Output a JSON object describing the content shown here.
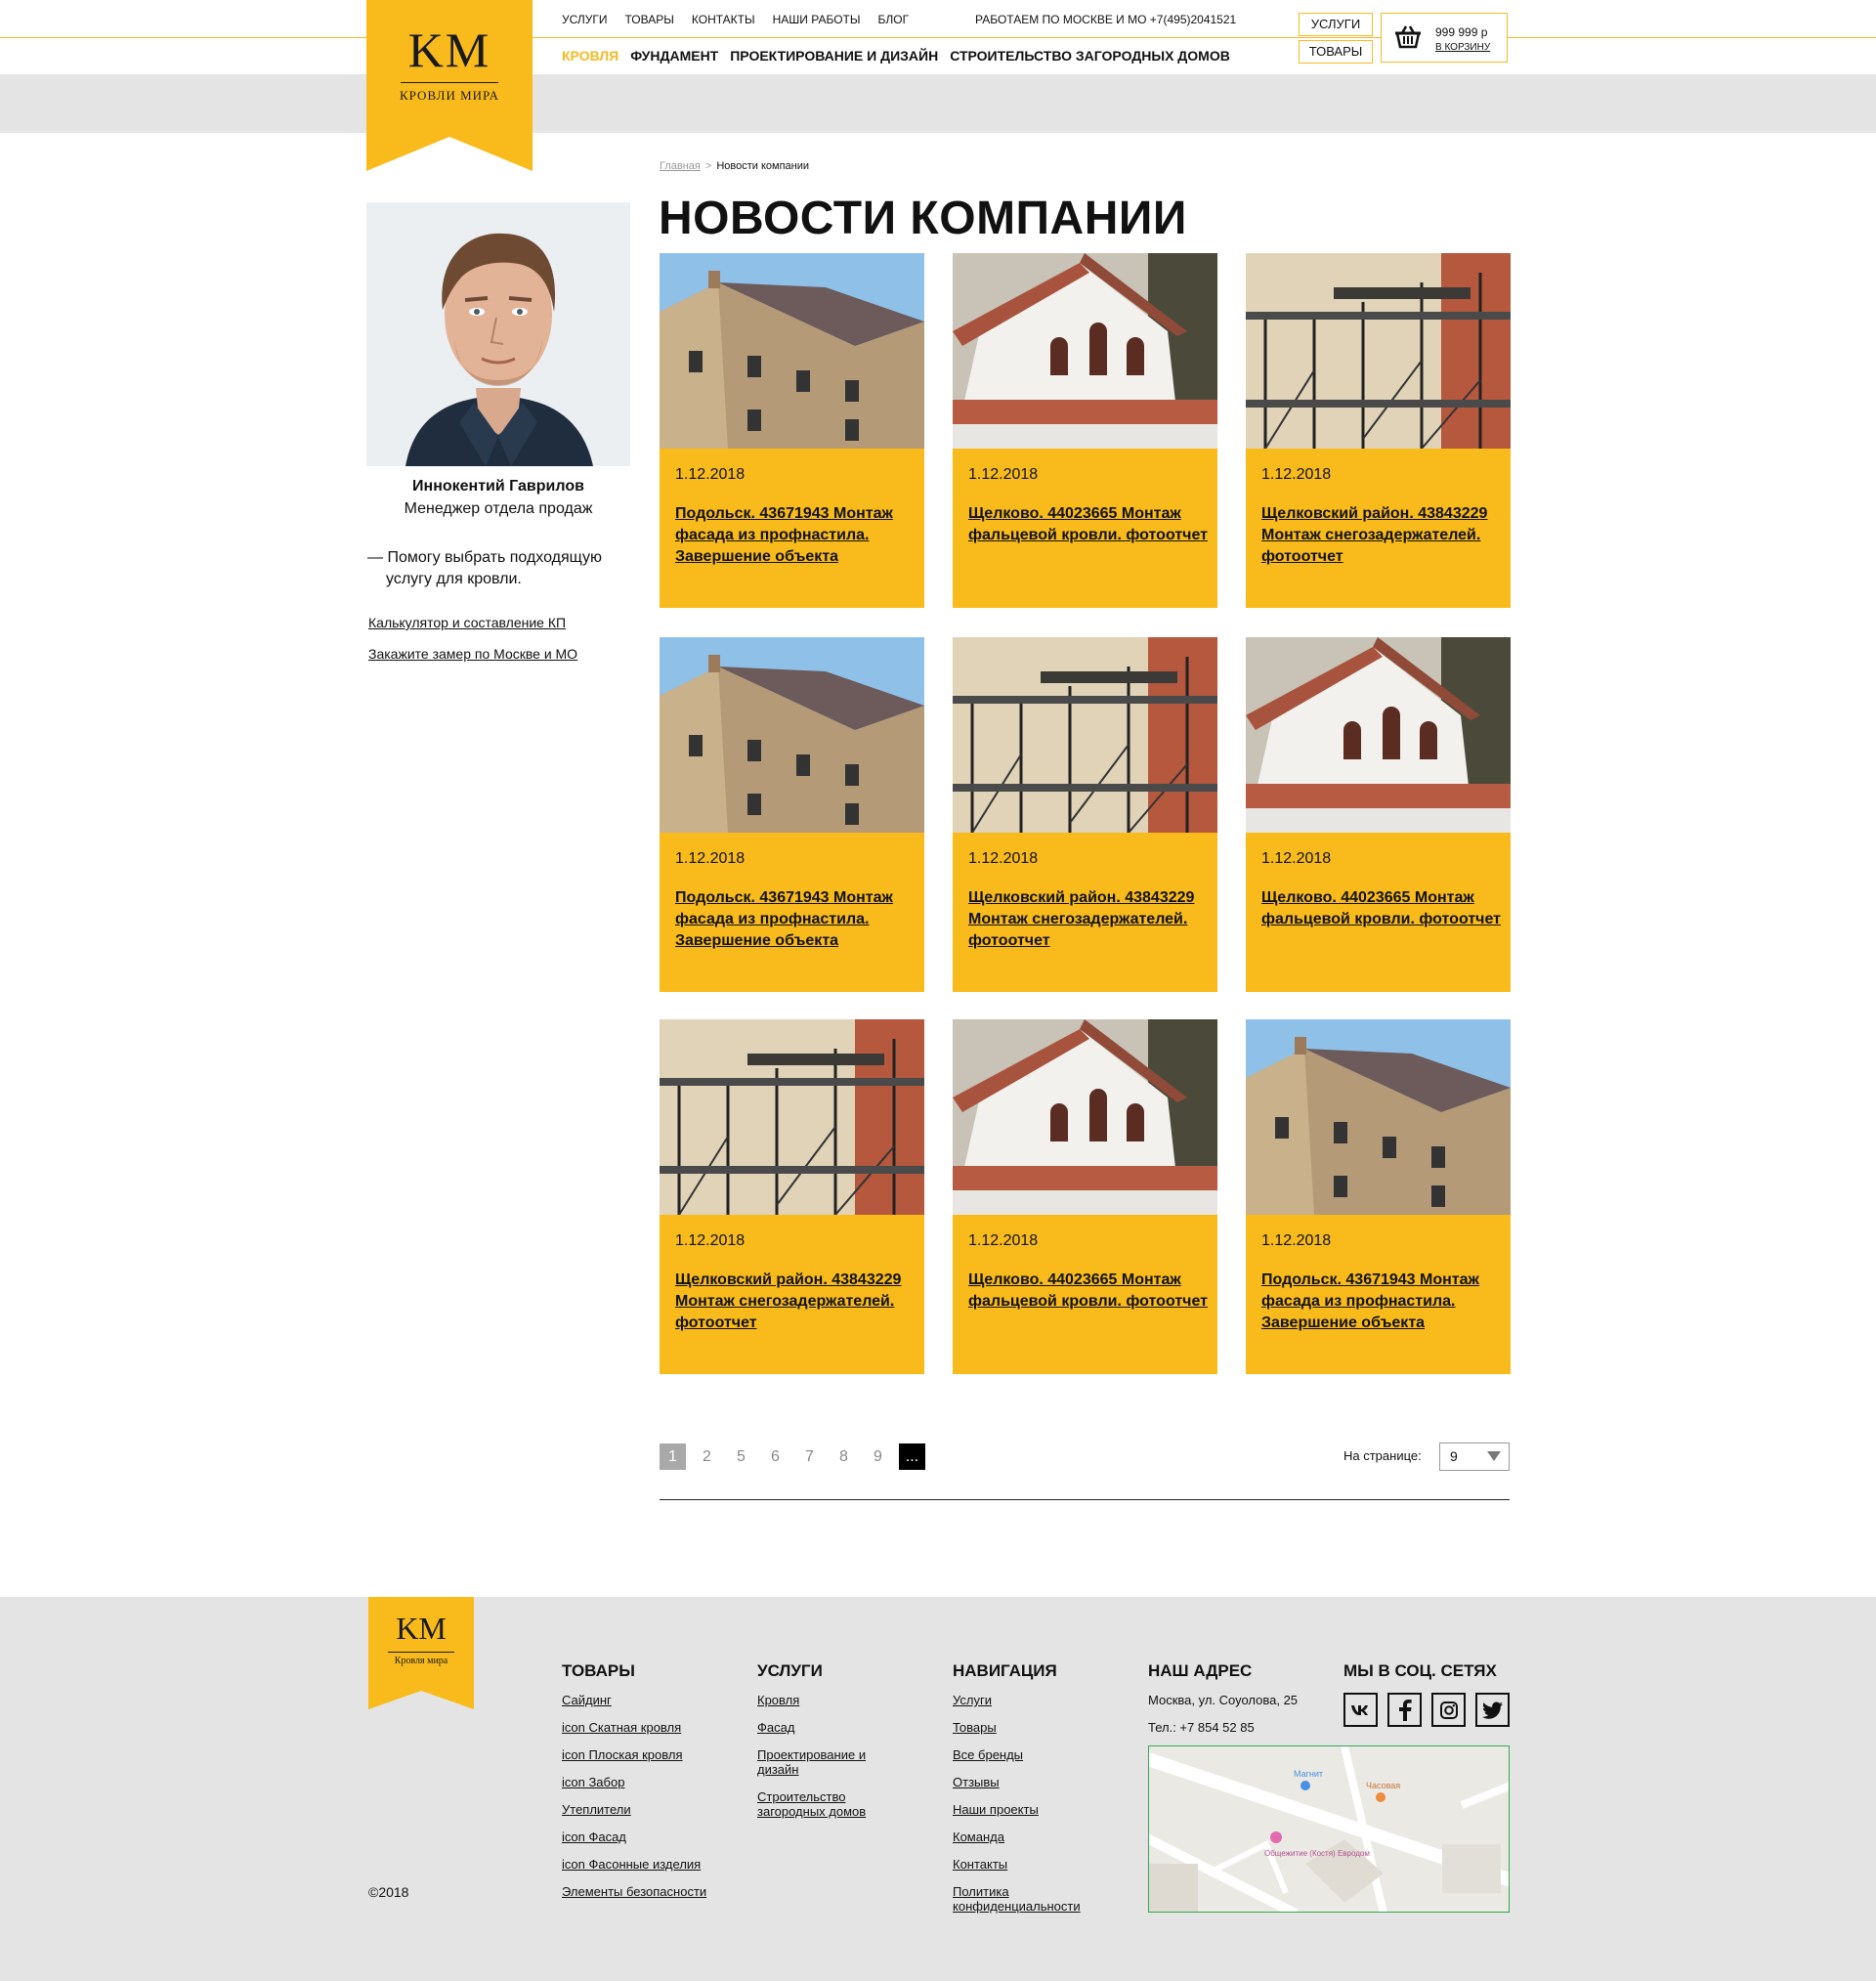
{
  "header": {
    "logo": "KM",
    "logo_sub": "КРОВЛИ МИРА",
    "top_nav": [
      "Услуги",
      "Товары",
      "Контакты",
      "Наши работы",
      "Блог"
    ],
    "worktime": "РАБОТАЕМ ПО МОСКВЕ И МО +7(495)2041521",
    "main_nav": [
      "Кровля",
      "Фундамент",
      "Проектирование и дизайн",
      "Строительство загородных домов"
    ],
    "btn_services": "УСЛУГИ",
    "btn_goods": "ТОВАРЫ",
    "cart_sum": "999 999 р",
    "cart_link": "В КОРЗИНУ"
  },
  "manager": {
    "name": "Иннокентий Гаврилов",
    "role": "Менеджер отдела продаж",
    "help": "— Помогу выбрать подходящую услугу для кровли.",
    "link1": "Калькулятор и составление КП",
    "link2": "Закажите замер по Москве и МО"
  },
  "breadcrumbs": {
    "home": "Главная",
    "sep": ">",
    "current": "Новости компании"
  },
  "title": "НОВОСТИ КОМПАНИИ",
  "news": [
    {
      "date": "1.12.2018",
      "title": "Подольск. 43671943 Монтаж фасада из профнастила. Завершение объекта",
      "img": "brick"
    },
    {
      "date": "1.12.2018",
      "title": "Щелково. 44023665 Монтаж фальцевой кровли. фотоотчет",
      "img": "white"
    },
    {
      "date": "1.12.2018",
      "title": "Щелковский район. 43843229 Монтаж снегозадержателей. фотоотчет",
      "img": "scaffold"
    },
    {
      "date": "1.12.2018",
      "title": "Подольск. 43671943 Монтаж фасада из профнастила. Завершение объекта",
      "img": "brick"
    },
    {
      "date": "1.12.2018",
      "title": "Щелковский район. 43843229 Монтаж снегозадержателей. фотоотчет",
      "img": "scaffold"
    },
    {
      "date": "1.12.2018",
      "title": "Щелково. 44023665 Монтаж фальцевой кровли. фотоотчет",
      "img": "white"
    },
    {
      "date": "1.12.2018",
      "title": "Щелковский район. 43843229 Монтаж снегозадержателей. фотоотчет",
      "img": "scaffold"
    },
    {
      "date": "1.12.2018",
      "title": "Щелково. 44023665 Монтаж фальцевой кровли. фотоотчет",
      "img": "white"
    },
    {
      "date": "1.12.2018",
      "title": "Подольск. 43671943 Монтаж фасада из профнастила. Завершение объекта",
      "img": "brick"
    }
  ],
  "pagination": {
    "pages": [
      "1",
      "2",
      "5",
      "6",
      "7",
      "8",
      "9"
    ],
    "more": "...",
    "current": "1",
    "per_page_label": "На странице:",
    "per_page": "9"
  },
  "footer": {
    "logo": "KM",
    "logo_sub": "Кровля мира",
    "goods_title": "ТОВАРЫ",
    "goods": [
      "Сайдинг",
      "icon Скатная кровля",
      "icon Плоская кровля",
      "icon Забор",
      "Утеплители",
      "icon Фасад",
      "icon Фасонные изделия",
      "Элементы безопасности"
    ],
    "services_title": "УСЛУГИ",
    "services": [
      "Кровля",
      "Фасад",
      "Проектирование и дизайн",
      "Строительство загородных домов"
    ],
    "nav_title": "НАВИГАЦИЯ",
    "nav": [
      "Услуги",
      "Товары",
      "Все бренды",
      "Отзывы",
      "Наши проекты",
      "Команда",
      "Контакты",
      "Политика конфиденциальности"
    ],
    "address_title": "НАШ АДРЕС",
    "address": "Москва, ул. Соуолова, 25",
    "phone": "Тел.: +7 854 52 85",
    "social_title": "МЫ В СОЦ. СЕТЯХ",
    "social": [
      "vk-icon",
      "facebook-icon",
      "instagram-icon",
      "twitter-icon"
    ],
    "map_labels": [
      "Магнит",
      "Часовая",
      "Общежитие (Костя) Евродом"
    ],
    "copyright": "©2018"
  },
  "colors": {
    "accent": "#f9bb1b",
    "band": "#e4e4e4"
  }
}
